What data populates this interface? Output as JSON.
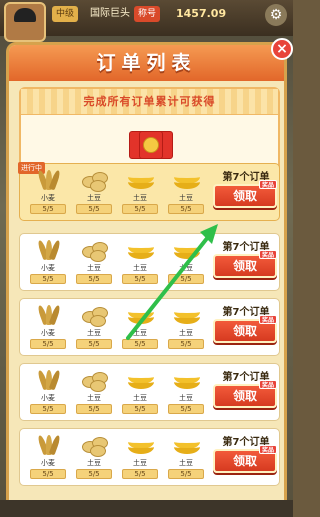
{
  "topbar": {
    "level": "中级",
    "title": "国际巨头",
    "badge": "称号",
    "money": "1457.09"
  },
  "modal": {
    "title": "订单列表",
    "close": "×",
    "reward_text": "完成所有订单累计可获得"
  },
  "orders": [
    {
      "tag": "进行中",
      "title": "第7个订单",
      "claim": "领取",
      "mini": "奖品",
      "items": [
        {
          "name": "小麦",
          "count": "5/5",
          "icon": "wheat-icon"
        },
        {
          "name": "土豆",
          "count": "5/5",
          "icon": "potato-icon"
        },
        {
          "name": "土豆",
          "count": "5/5",
          "icon": "banana-icon"
        },
        {
          "name": "土豆",
          "count": "5/5",
          "icon": "banana-icon"
        }
      ]
    },
    {
      "title": "第7个订单",
      "claim": "领取",
      "mini": "奖品",
      "items": [
        {
          "name": "小麦",
          "count": "5/5",
          "icon": "wheat-icon"
        },
        {
          "name": "土豆",
          "count": "5/5",
          "icon": "potato-icon"
        },
        {
          "name": "土豆",
          "count": "5/5",
          "icon": "banana-icon"
        },
        {
          "name": "土豆",
          "count": "5/5",
          "icon": "banana-icon"
        }
      ]
    },
    {
      "title": "第7个订单",
      "claim": "领取",
      "mini": "奖品",
      "items": [
        {
          "name": "小麦",
          "count": "5/5",
          "icon": "wheat-icon"
        },
        {
          "name": "土豆",
          "count": "5/5",
          "icon": "potato-icon"
        },
        {
          "name": "土豆",
          "count": "5/5",
          "icon": "banana-icon"
        },
        {
          "name": "土豆",
          "count": "5/5",
          "icon": "banana-icon"
        }
      ]
    },
    {
      "title": "第7个订单",
      "claim": "领取",
      "mini": "奖品",
      "items": [
        {
          "name": "小麦",
          "count": "5/5",
          "icon": "wheat-icon"
        },
        {
          "name": "土豆",
          "count": "5/5",
          "icon": "potato-icon"
        },
        {
          "name": "土豆",
          "count": "5/5",
          "icon": "banana-icon"
        },
        {
          "name": "土豆",
          "count": "5/5",
          "icon": "banana-icon"
        }
      ]
    },
    {
      "title": "第7个订单",
      "claim": "领取",
      "mini": "奖品",
      "items": [
        {
          "name": "小麦",
          "count": "5/5",
          "icon": "wheat-icon"
        },
        {
          "name": "土豆",
          "count": "5/5",
          "icon": "potato-icon"
        },
        {
          "name": "土豆",
          "count": "5/5",
          "icon": "banana-icon"
        },
        {
          "name": "土豆",
          "count": "5/5",
          "icon": "banana-icon"
        }
      ]
    }
  ],
  "colors": {
    "accent": "#e2672a",
    "claim_button": "#d63a20",
    "panel": "#f6e7b8",
    "arrow": "#2fbf4a"
  }
}
